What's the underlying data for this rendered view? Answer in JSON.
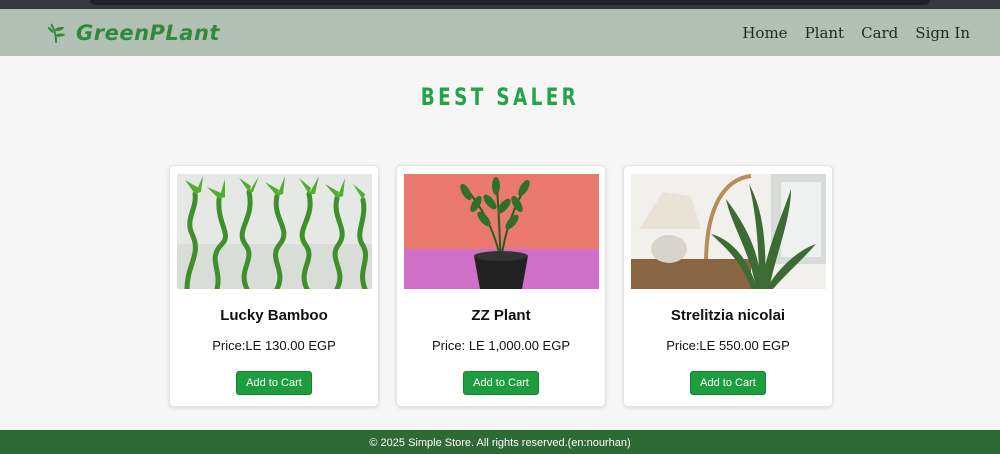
{
  "header": {
    "brand": "GreenPLant",
    "brand_color": "#2f8a3e",
    "nav": [
      "Home",
      "Plant",
      "Card",
      "Sign In"
    ]
  },
  "section": {
    "title": "BEST SALER"
  },
  "products": [
    {
      "name": "Lucky Bamboo",
      "price": "Price:LE 130.00 EGP",
      "button": "Add to Cart",
      "image": "lucky-bamboo-photo"
    },
    {
      "name": "ZZ Plant",
      "price": "Price: LE 1,000.00 EGP",
      "button": "Add to Cart",
      "image": "zz-plant-photo"
    },
    {
      "name": "Strelitzia nicolai",
      "price": "Price:LE 550.00 EGP",
      "button": "Add to Cart",
      "image": "strelitzia-photo"
    }
  ],
  "footer": {
    "text": "© 2025 Simple Store. All rights reserved.(en:nourhan)"
  },
  "colors": {
    "accent": "#24a347",
    "navbar": "#b2c1b3",
    "footer": "#2e6a33",
    "button": "#1e9d3f"
  }
}
